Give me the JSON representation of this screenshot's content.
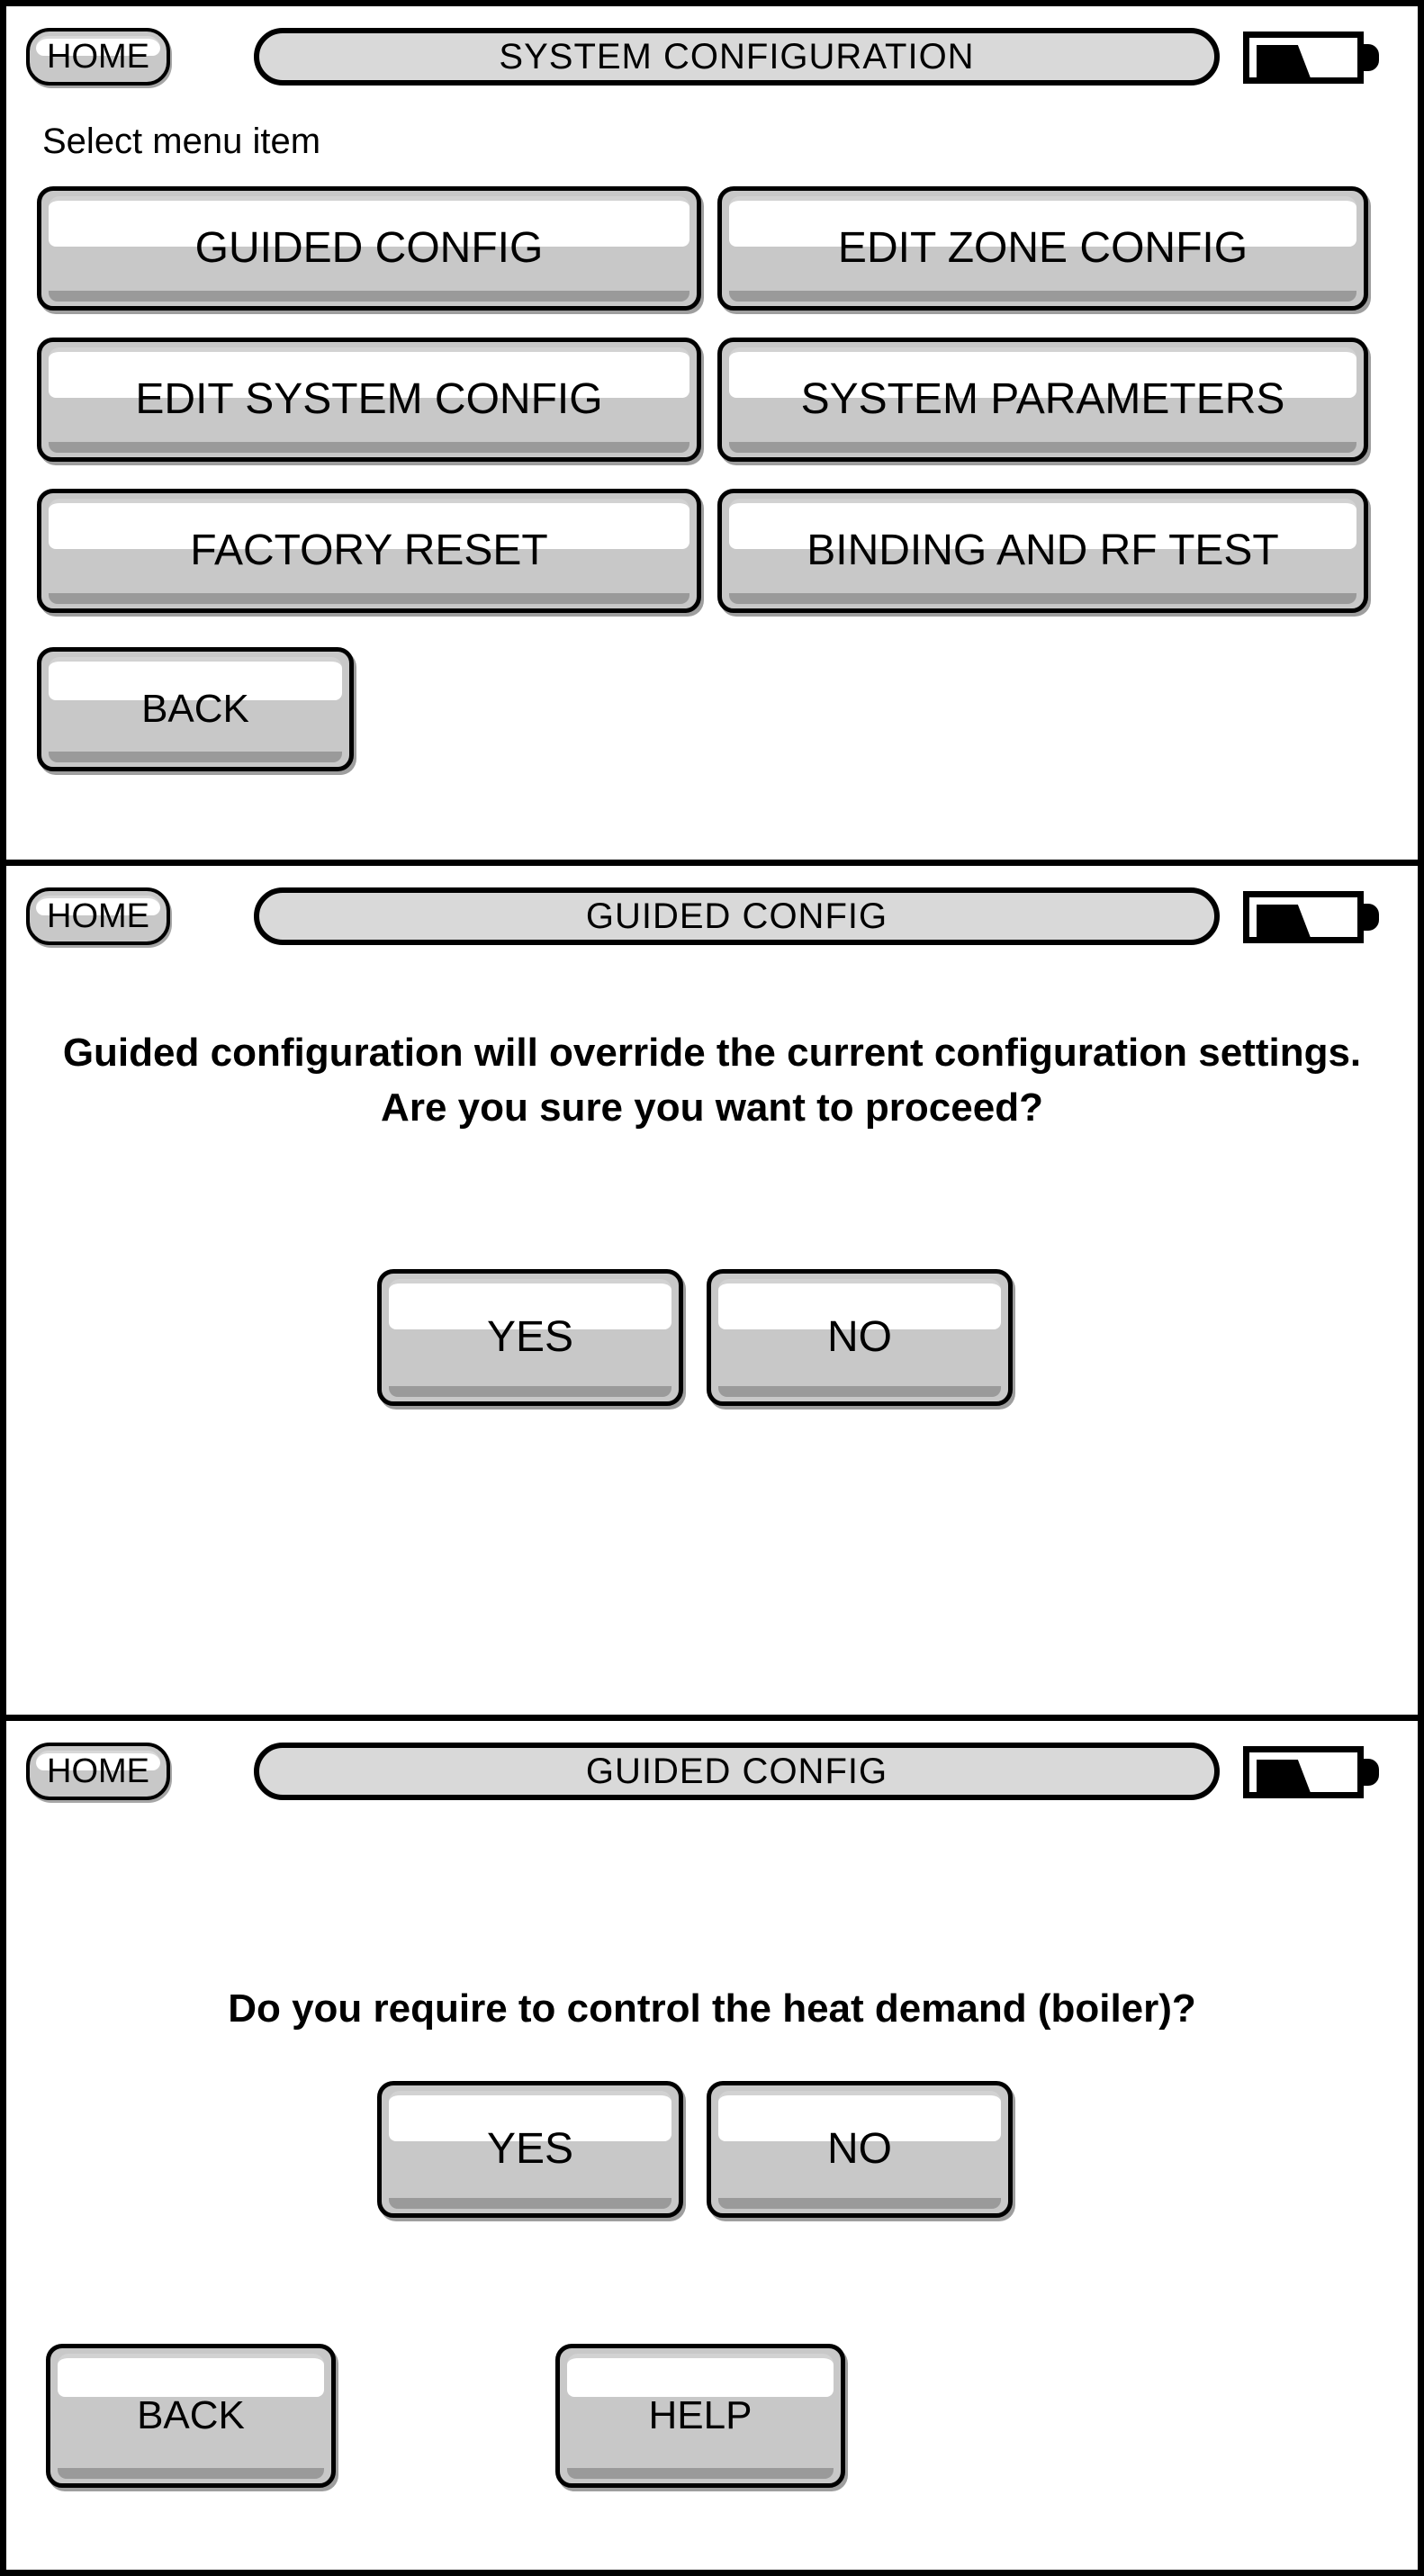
{
  "device": {
    "screen_count": 3,
    "colors": {
      "border": "#000000",
      "button_face": "#c8c8c8",
      "button_highlight": "#ffffff",
      "titlebar_face": "#d9d9d9",
      "background": "#ffffff"
    }
  },
  "panels": [
    {
      "id": "system-configuration",
      "header": {
        "home_label": "HOME",
        "title": "SYSTEM CONFIGURATION",
        "battery_icon": "battery-icon"
      },
      "hint": "Select menu item",
      "menu_items": [
        {
          "label": "GUIDED CONFIG"
        },
        {
          "label": "EDIT ZONE CONFIG"
        },
        {
          "label": "EDIT SYSTEM CONFIG"
        },
        {
          "label": "SYSTEM PARAMETERS"
        },
        {
          "label": "FACTORY RESET"
        },
        {
          "label": "BINDING AND RF TEST"
        }
      ],
      "back_label": "BACK"
    },
    {
      "id": "guided-config-confirm",
      "header": {
        "home_label": "HOME",
        "title": "GUIDED CONFIG",
        "battery_icon": "battery-icon"
      },
      "message": "Guided configuration will override the current configuration settings.\nAre you sure you want to proceed?",
      "yes_label": "YES",
      "no_label": "NO"
    },
    {
      "id": "guided-config-heat-demand",
      "header": {
        "home_label": "HOME",
        "title": "GUIDED CONFIG",
        "battery_icon": "battery-icon"
      },
      "message": "Do you require to control the heat demand (boiler)?",
      "yes_label": "YES",
      "no_label": "NO",
      "back_label": "BACK",
      "help_label": "HELP"
    }
  ]
}
